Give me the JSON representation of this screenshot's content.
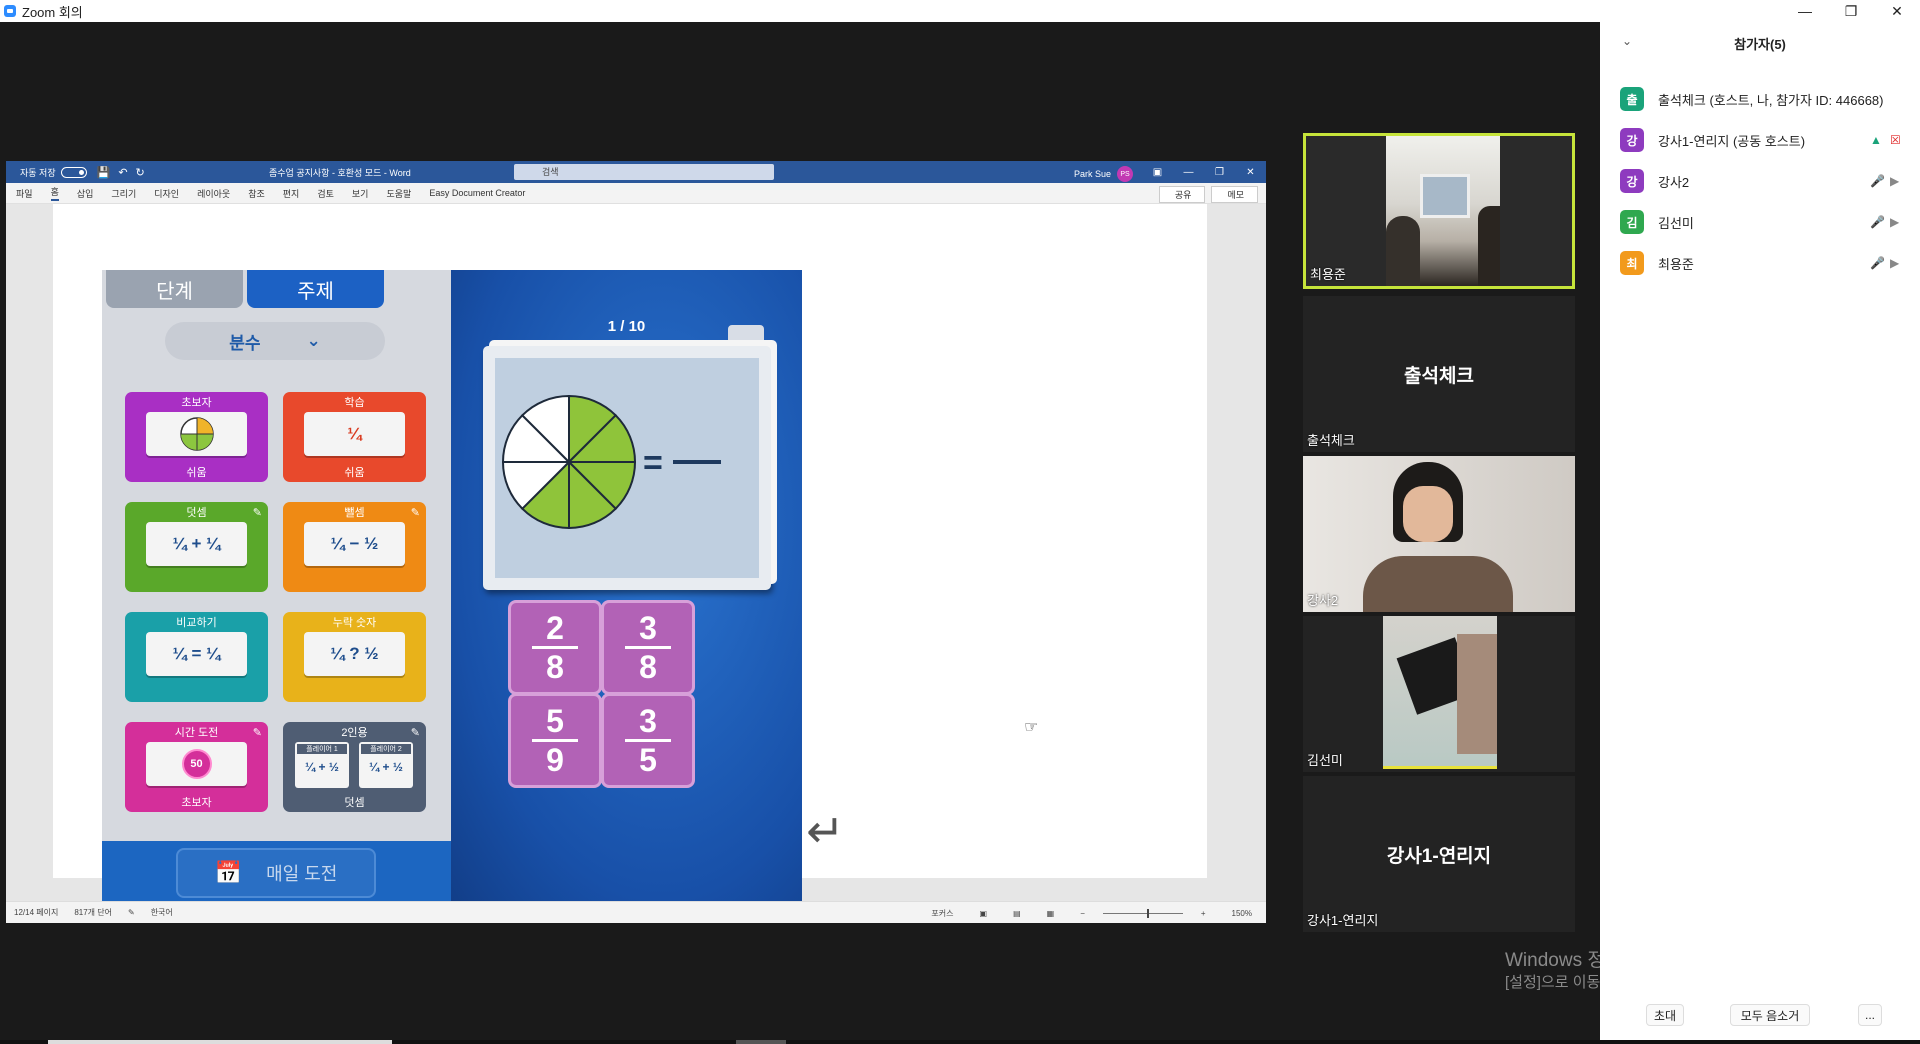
{
  "window": {
    "title": "Zoom 회의"
  },
  "word": {
    "autosave": "자동 저장",
    "doc_title": "좀수업 공지사항 - 호환성 모드 - Word",
    "search_placeholder": "검색",
    "user": "Park Sue",
    "user_initials": "PS",
    "tabs": [
      "파일",
      "홈",
      "삽입",
      "그리기",
      "디자인",
      "레이아웃",
      "참조",
      "편지",
      "검토",
      "보기",
      "도움말",
      "Easy Document Creator"
    ],
    "share": "공유",
    "memo": "메모",
    "status": {
      "page": "12/14 페이지",
      "words": "817개 단어",
      "lang": "한국어",
      "focus": "포커스",
      "zoom": "150%"
    }
  },
  "game": {
    "tab_level": "단계",
    "tab_topic": "주제",
    "dropdown": "분수",
    "tiles": [
      {
        "label": "초보자",
        "sub": "쉬움",
        "card": ""
      },
      {
        "label": "학습",
        "sub": "쉬움",
        "card": "¼"
      },
      {
        "label": "덧셈",
        "sub": "",
        "card": "¼ + ¼"
      },
      {
        "label": "뺄셈",
        "sub": "",
        "card": "¼ − ½"
      },
      {
        "label": "비교하기",
        "sub": "",
        "card": "¼ = ¼"
      },
      {
        "label": "누락 숫자",
        "sub": "",
        "card": "¼ ? ½"
      },
      {
        "label": "시간 도전",
        "sub": "초보자",
        "card": "50"
      },
      {
        "label": "2인용",
        "sub": "덧셈",
        "card": ""
      }
    ],
    "player1": "플레이어 1",
    "player2": "플레이어 2",
    "p_card": "¼ + ½",
    "daily": "매일 도전",
    "counter": "1 / 10",
    "equals": "=",
    "answers": [
      {
        "n": "2",
        "d": "8"
      },
      {
        "n": "3",
        "d": "8"
      },
      {
        "n": "5",
        "d": "9"
      },
      {
        "n": "3",
        "d": "5"
      }
    ],
    "question_shaded": 5,
    "question_total": 8
  },
  "videos": [
    {
      "name": "최용준",
      "type": "video",
      "active": true
    },
    {
      "name": "출석체크",
      "type": "name",
      "center": "출석체크"
    },
    {
      "name": "강사2",
      "type": "video"
    },
    {
      "name": "김선미",
      "type": "video"
    },
    {
      "name": "강사1-연리지",
      "type": "name",
      "center": "강사1-연리지"
    }
  ],
  "participants": {
    "title": "참가자(5)",
    "list": [
      {
        "initial": "출",
        "name": "출석체크 (호스트, 나, 참가자 ID: 446668)",
        "color": "#1aa37a"
      },
      {
        "initial": "강",
        "name": "강사1-연리지 (공동 호스트)",
        "color": "#8e3bbf"
      },
      {
        "initial": "강",
        "name": "강사2",
        "color": "#8e3bbf"
      },
      {
        "initial": "김",
        "name": "김선미",
        "color": "#2fa84f"
      },
      {
        "initial": "최",
        "name": "최용준",
        "color": "#f29a1c"
      }
    ],
    "invite": "초대",
    "mute_all": "모두 음소거",
    "more": "..."
  },
  "activation": {
    "line1": "Windows 정품 인증",
    "line2": "[설정]으로 이동하여 Windows를 정품 인증합니다."
  },
  "colors": {
    "word_blue": "#2b579a",
    "active_speaker": "#c6e43a",
    "zoom_blue": "#2d8cff"
  }
}
